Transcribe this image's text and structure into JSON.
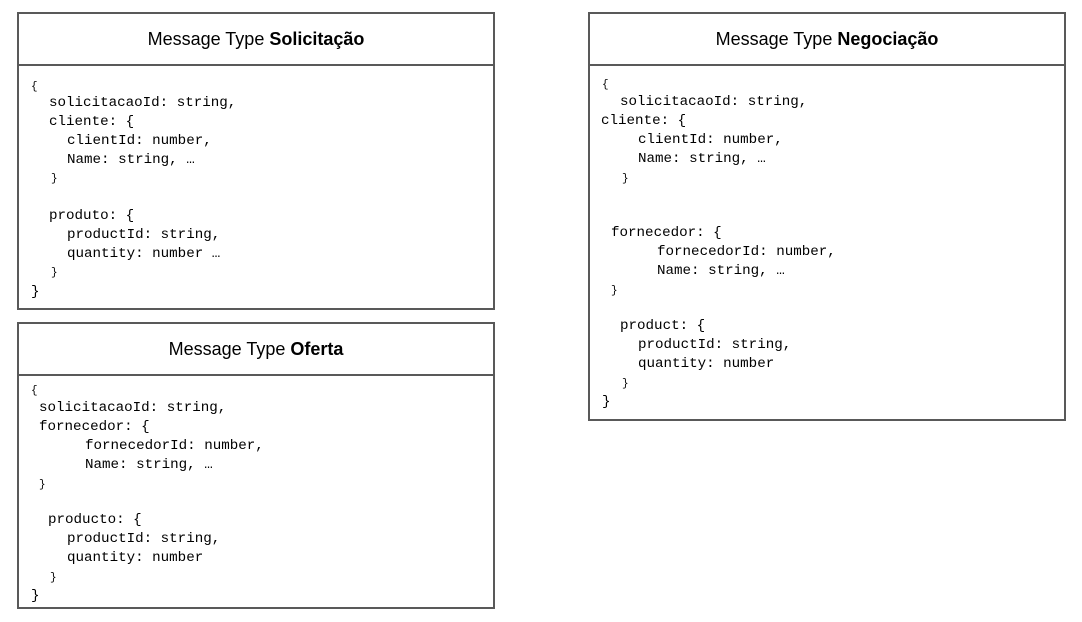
{
  "cards": {
    "solicitacao": {
      "prefix": "Message Type ",
      "name": "Solicitação",
      "lines": [
        "{",
        "solicitacaoId: string,",
        "cliente: {",
        "clientId: number,",
        "Name: string, …",
        "}",
        "produto: {",
        "productId: string,",
        "quantity: number …",
        "}",
        "}"
      ]
    },
    "oferta": {
      "prefix": "Message Type ",
      "name": "Oferta",
      "lines": [
        "{",
        "solicitacaoId: string,",
        "fornecedor: {",
        "fornecedorId: number,",
        "Name: string, …",
        "}",
        "producto: {",
        "productId: string,",
        "quantity: number",
        "}",
        "}"
      ]
    },
    "negociacao": {
      "prefix": "Message Type ",
      "name": "Negociação",
      "lines": [
        "{",
        "solicitacaoId: string,",
        "cliente: {",
        "clientId: number,",
        "Name: string, …",
        "}",
        "fornecedor: {",
        "fornecedorId: number,",
        "Name: string, …",
        "}",
        "product: {",
        "productId: string,",
        "quantity: number",
        "}",
        "}"
      ]
    }
  }
}
